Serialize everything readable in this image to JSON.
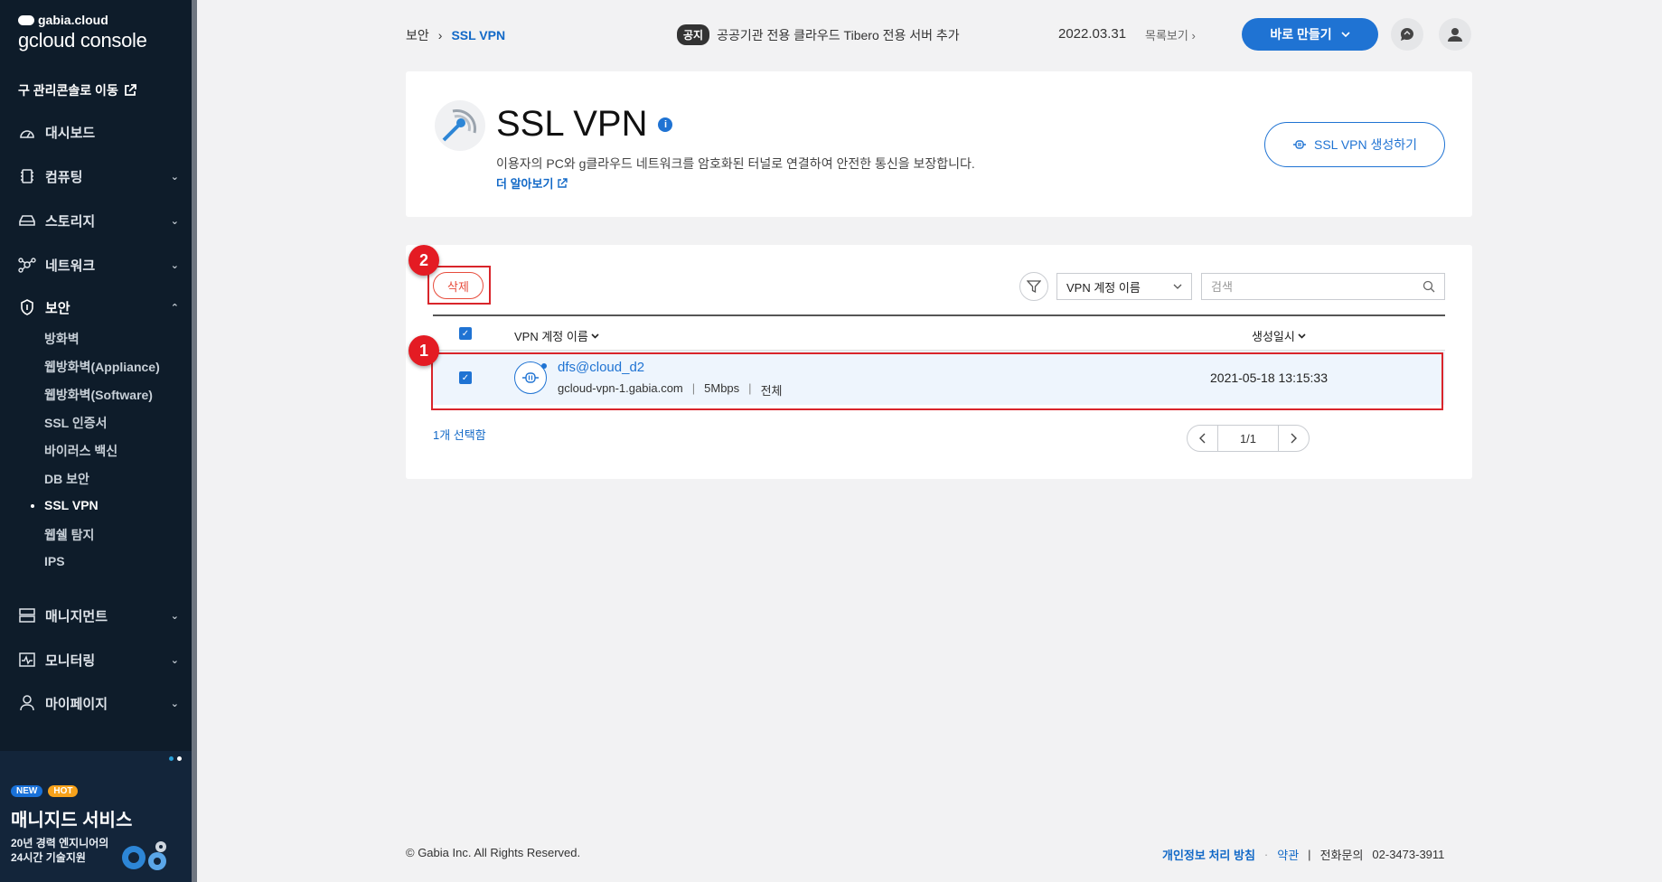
{
  "sidebar": {
    "brand_top": "gabia.cloud",
    "brand_main": "gcloud console",
    "legacy_link": "구 관리콘솔로 이동",
    "nav": [
      {
        "label": "대시보드"
      },
      {
        "label": "컴퓨팅"
      },
      {
        "label": "스토리지"
      },
      {
        "label": "네트워크"
      },
      {
        "label": "보안"
      },
      {
        "label": "매니지먼트"
      },
      {
        "label": "모니터링"
      },
      {
        "label": "마이페이지"
      }
    ],
    "security_sub": [
      "방화벽",
      "웹방화벽(Appliance)",
      "웹방화벽(Software)",
      "SSL 인증서",
      "바이러스 백신",
      "DB 보안",
      "SSL VPN",
      "웹쉘 탐지",
      "IPS"
    ],
    "promo": {
      "badge_new": "NEW",
      "badge_hot": "HOT",
      "title": "매니지드 서비스",
      "desc_line1": "20년 경력 엔지니어의",
      "desc_line2": "24시간 기술지원"
    }
  },
  "header": {
    "breadcrumb_root": "보안",
    "breadcrumb_sep": "›",
    "breadcrumb_current": "SSL VPN",
    "notice_tag": "공지",
    "notice_text": "공공기관 전용 클라우드 Tibero 전용 서버 추가",
    "notice_date": "2022.03.31",
    "notice_more": "목록보기",
    "create_label": "바로 만들기"
  },
  "hero": {
    "title": "SSL VPN",
    "info": "i",
    "desc": "이용자의 PC와 g클라우드 네트워크를 암호화된 터널로 연결하여 안전한 통신을 보장합니다.",
    "learn_more": "더 알아보기",
    "create_button": "SSL VPN 생성하기"
  },
  "list": {
    "delete_label": "삭제",
    "filter_select": "VPN 계정 이름",
    "search_placeholder": "검색",
    "col_name": "VPN 계정 이름",
    "col_date": "생성일시",
    "rows": [
      {
        "name": "dfs@cloud_d2",
        "host": "gcloud-vpn-1.gabia.com",
        "bandwidth": "5Mbps",
        "scope": "전체",
        "created": "2021-05-18 13:15:33"
      }
    ],
    "selected_count": "1개 선택함",
    "page": "1/1"
  },
  "annotations": {
    "one": "1",
    "two": "2"
  },
  "footer": {
    "copyright": "© Gabia Inc. All Rights Reserved.",
    "privacy": "개인정보 처리 방침",
    "dot": "·",
    "terms": "약관",
    "bar": "|",
    "phone_label": "전화문의",
    "phone": "02-3473-3911"
  },
  "colors": {
    "accent": "#1f73d3",
    "sidebar_bg": "#0e1c2a",
    "annotation": "#e41b23",
    "delete": "#e74c3c"
  }
}
